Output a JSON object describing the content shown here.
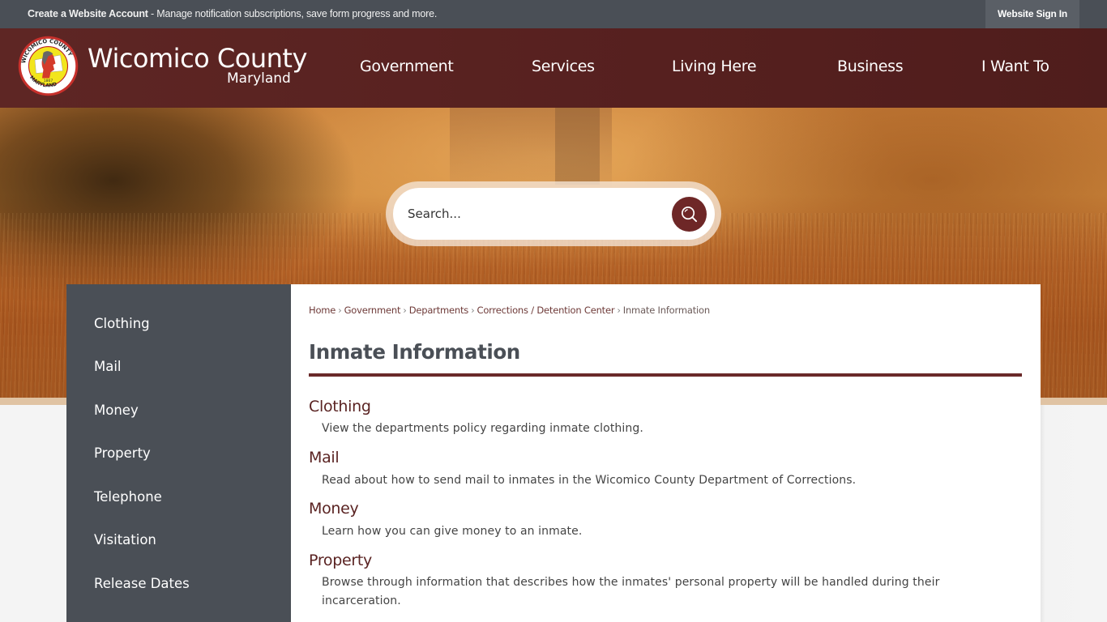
{
  "topbar": {
    "account_link": "Create a Website Account",
    "account_message": " - Manage notification subscriptions, save form progress and more.",
    "signin_label": "Website Sign In"
  },
  "header": {
    "logo_icon": "county-seal-icon",
    "title": "Wicomico County",
    "subtitle": "Maryland",
    "nav": [
      {
        "label": "Government"
      },
      {
        "label": "Services"
      },
      {
        "label": "Living Here"
      },
      {
        "label": "Business"
      },
      {
        "label": "I Want To"
      }
    ]
  },
  "search": {
    "placeholder": "Search...",
    "value": "",
    "button_icon": "search-icon"
  },
  "sidebar": {
    "items": [
      {
        "label": "Clothing"
      },
      {
        "label": "Mail"
      },
      {
        "label": "Money"
      },
      {
        "label": "Property"
      },
      {
        "label": "Telephone"
      },
      {
        "label": "Visitation"
      },
      {
        "label": "Release Dates"
      }
    ]
  },
  "breadcrumb": {
    "items": [
      {
        "label": "Home"
      },
      {
        "label": "Government"
      },
      {
        "label": "Departments"
      },
      {
        "label": "Corrections / Detention Center"
      }
    ],
    "separator": "›",
    "current": "Inmate Information"
  },
  "page": {
    "title": "Inmate Information",
    "sections": [
      {
        "title": "Clothing",
        "description": "View the departments policy regarding inmate clothing."
      },
      {
        "title": "Mail",
        "description": "Read about how to send mail to inmates in the Wicomico County Department of Corrections."
      },
      {
        "title": "Money",
        "description": "Learn how you can give money to an inmate."
      },
      {
        "title": "Property",
        "description": "Browse through information that describes how the inmates' personal property will be handled during their incarceration."
      }
    ]
  },
  "colors": {
    "topbar": "#4a4f56",
    "header": "#5a2322",
    "accent": "#6e2727",
    "sidebar": "#4a4f56"
  }
}
